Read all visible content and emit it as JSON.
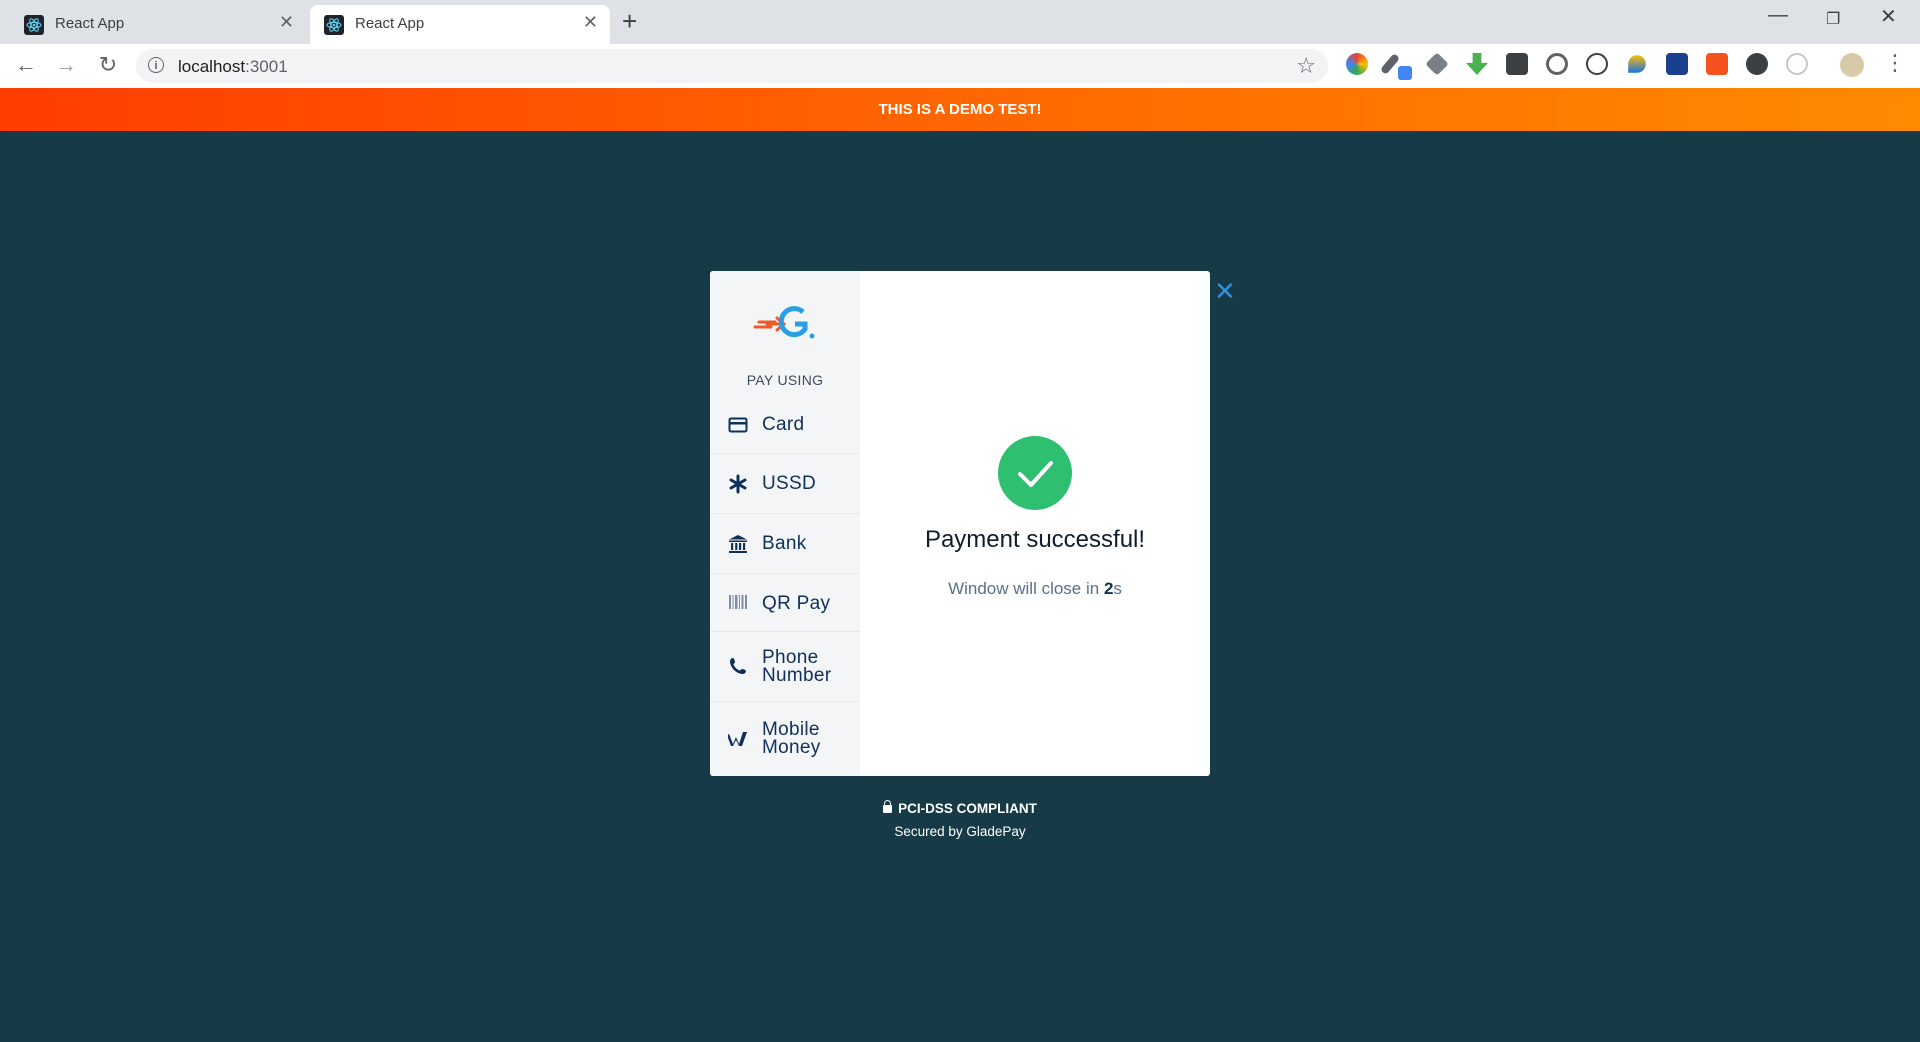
{
  "browser": {
    "tabs": [
      {
        "title": "React App",
        "active": false
      },
      {
        "title": "React App",
        "active": true
      }
    ],
    "address": {
      "host": "localhost",
      "port": ":3001"
    }
  },
  "banner": {
    "text": "THIS IS A DEMO TEST!"
  },
  "modal": {
    "pay_using": "PAY USING",
    "methods": [
      {
        "line1": "Card",
        "line2": "",
        "icon": "credit-card-icon"
      },
      {
        "line1": "USSD",
        "line2": "",
        "icon": "asterisk-icon"
      },
      {
        "line1": "Bank",
        "line2": "",
        "icon": "bank-icon"
      },
      {
        "line1": "QR Pay",
        "line2": "",
        "icon": "qr-code-icon"
      },
      {
        "line1": "Phone",
        "line2": "Number",
        "icon": "phone-icon"
      },
      {
        "line1": "Mobile",
        "line2": "Money",
        "icon": "wallet-icon"
      }
    ],
    "success_title": "Payment successful!",
    "close_prefix": "Window will close in ",
    "close_seconds": "2",
    "close_unit": "s"
  },
  "footer": {
    "compliance": "PCI-DSS COMPLIANT",
    "secured_by": "Secured by GladePay"
  },
  "colors": {
    "page_background": "#173a47",
    "banner_start": "#ff3d00",
    "banner_end": "#ff8a00",
    "success_green": "#2fbf71",
    "method_text": "#10305a",
    "close_icon": "#2f8fe0"
  }
}
